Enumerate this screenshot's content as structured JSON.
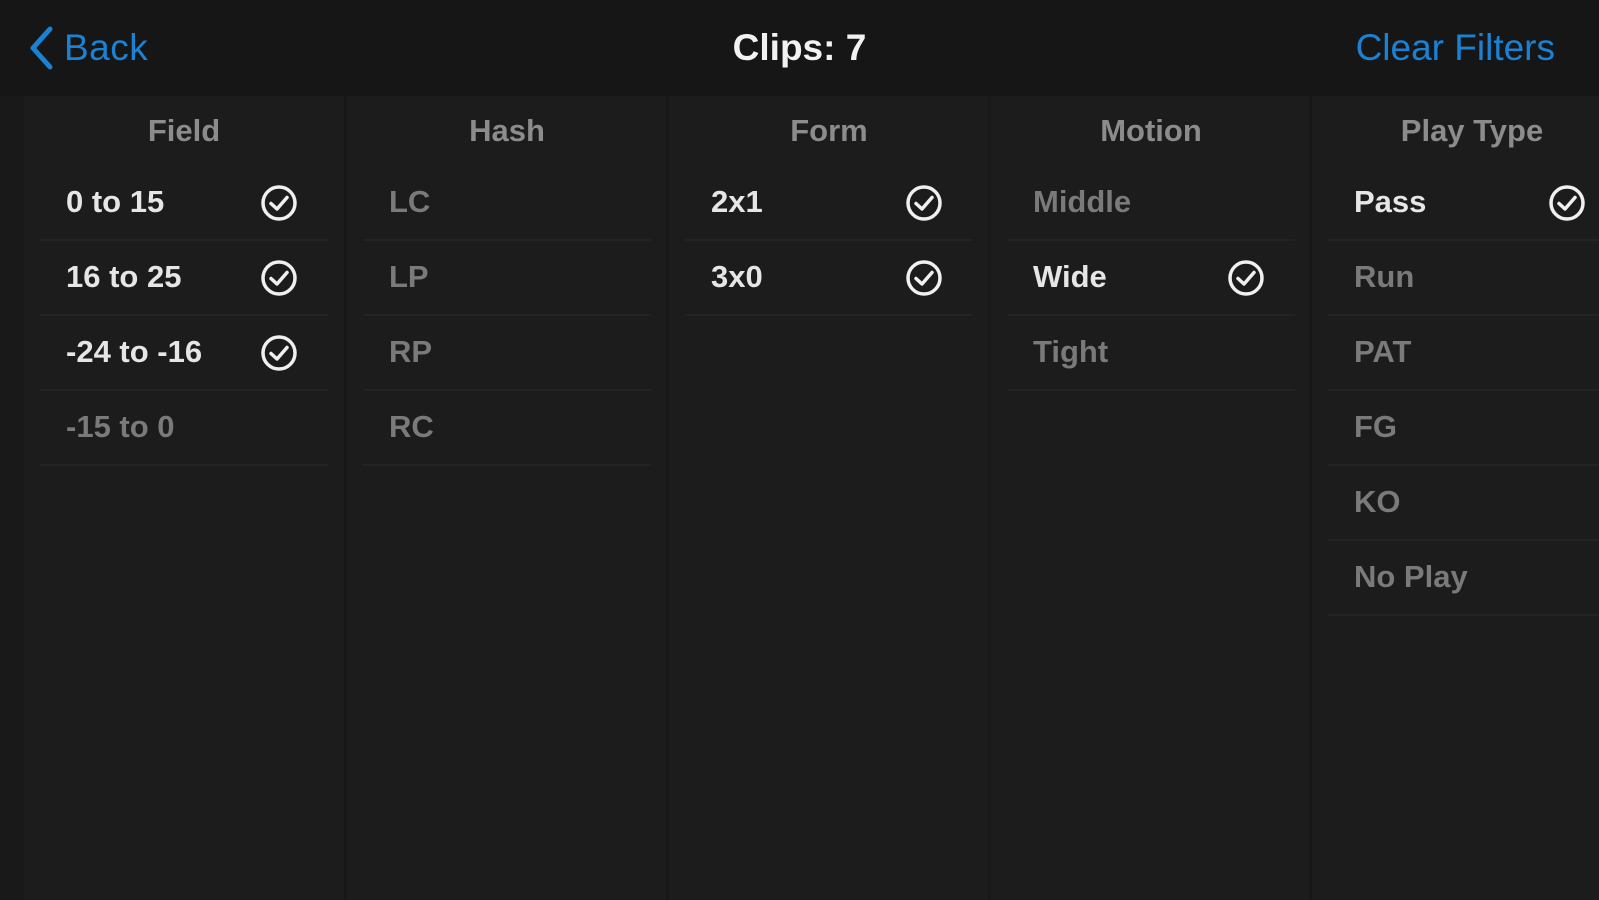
{
  "nav": {
    "back_label": "Back",
    "title": "Clips: 7",
    "clear_label": "Clear Filters"
  },
  "colors": {
    "accent": "#1a82d4",
    "selected_text": "#e6e6e6",
    "unselected_text": "#7a7a7a",
    "header_text": "#8c8c8c",
    "background": "#1e1e1e"
  },
  "columns": [
    {
      "header": "Field",
      "items": [
        {
          "label": "0 to 15",
          "selected": true
        },
        {
          "label": "16 to 25",
          "selected": true
        },
        {
          "label": "-24 to -16",
          "selected": true
        },
        {
          "label": "-15 to 0",
          "selected": false
        }
      ]
    },
    {
      "header": "Hash",
      "items": [
        {
          "label": "LC",
          "selected": false
        },
        {
          "label": "LP",
          "selected": false
        },
        {
          "label": "RP",
          "selected": false
        },
        {
          "label": "RC",
          "selected": false
        }
      ]
    },
    {
      "header": "Form",
      "items": [
        {
          "label": "2x1",
          "selected": true
        },
        {
          "label": "3x0",
          "selected": true
        }
      ]
    },
    {
      "header": "Motion",
      "items": [
        {
          "label": "Middle",
          "selected": false
        },
        {
          "label": "Wide",
          "selected": true
        },
        {
          "label": "Tight",
          "selected": false
        }
      ]
    },
    {
      "header": "Play Type",
      "items": [
        {
          "label": "Pass",
          "selected": true
        },
        {
          "label": "Run",
          "selected": false
        },
        {
          "label": "PAT",
          "selected": false
        },
        {
          "label": "FG",
          "selected": false
        },
        {
          "label": "KO",
          "selected": false
        },
        {
          "label": "No Play",
          "selected": false
        }
      ]
    }
  ]
}
